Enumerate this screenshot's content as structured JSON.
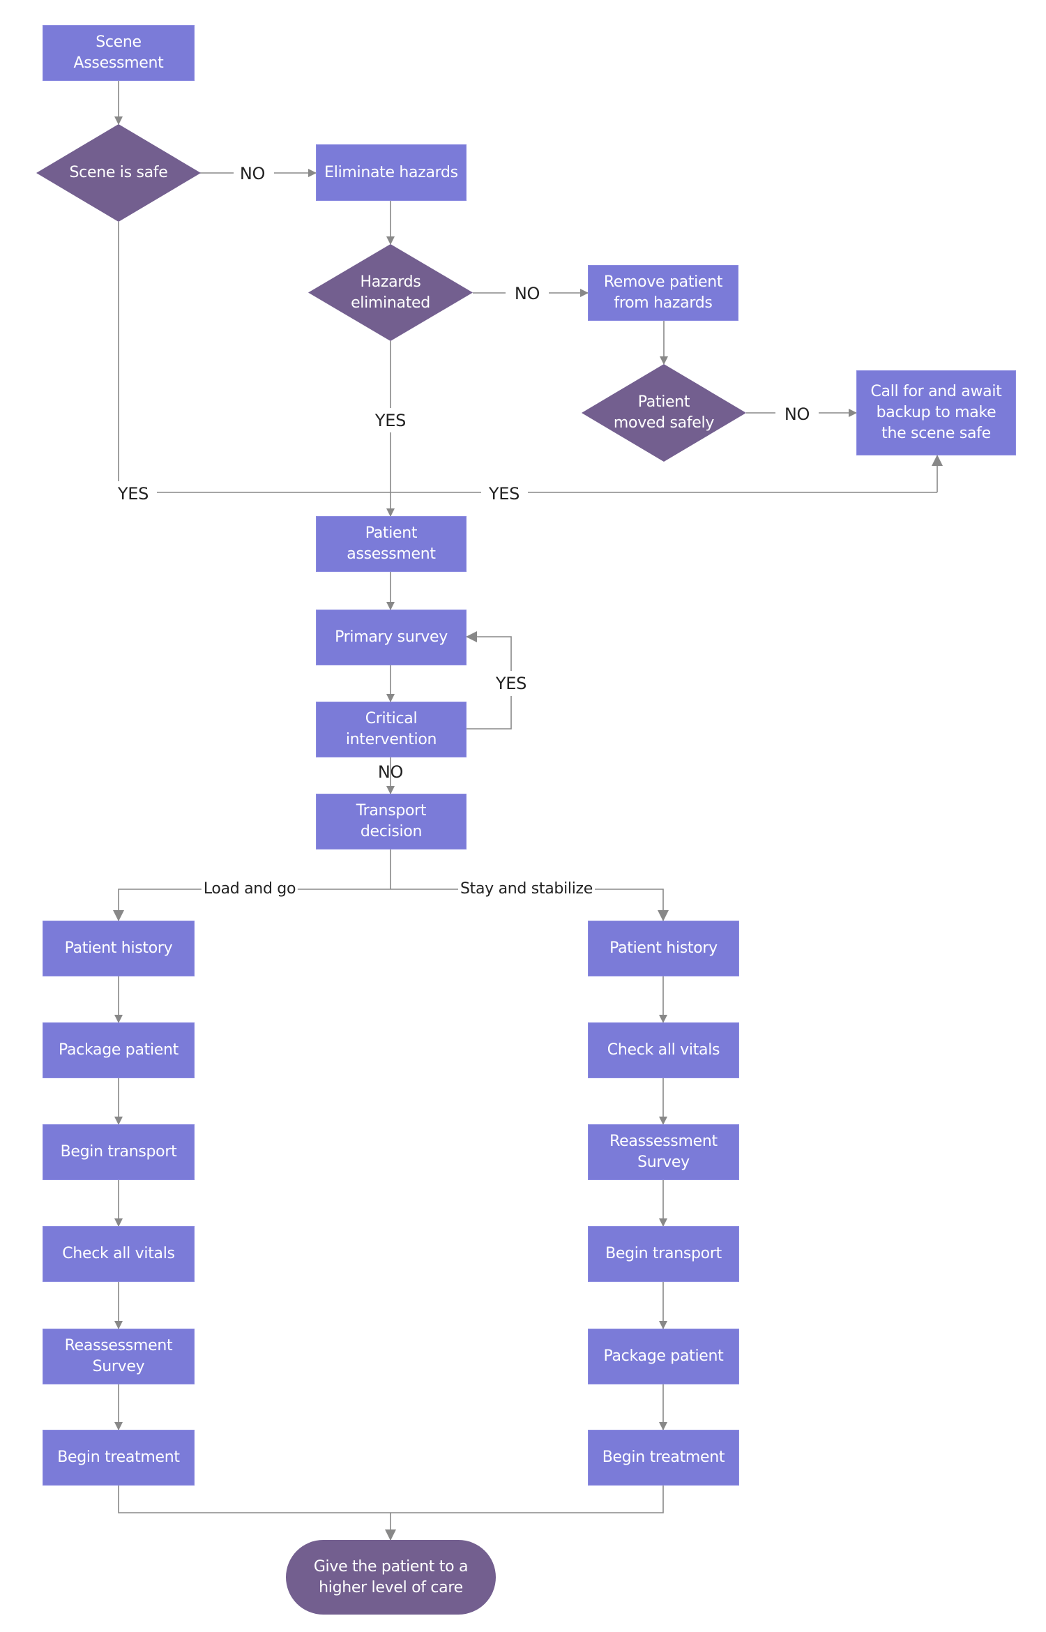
{
  "colors": {
    "process_fill": "#7b7bd8",
    "decision_fill": "#735f8f",
    "terminal_fill": "#735f8f",
    "connector": "#888888",
    "label_text": "#222222",
    "node_text": "#ffffff"
  },
  "nodes": {
    "scene_assessment": "Scene\nAssessment",
    "scene_is_safe": "Scene is safe",
    "eliminate_hazards": "Eliminate hazards",
    "hazards_eliminated": "Hazards\neliminated",
    "remove_patient": "Remove patient\nfrom hazards",
    "patient_moved_safely": "Patient\nmoved safely",
    "call_for_backup": "Call for and await\nbackup to make\nthe scene safe",
    "patient_assessment": "Patient\nassessment",
    "primary_survey": "Primary survey",
    "critical_intervention": "Critical\nintervention",
    "transport_decision": "Transport\ndecision",
    "give_patient": "Give the patient to a\nhigher level of care"
  },
  "load_and_go": {
    "branch_label": "Load and go",
    "steps": [
      "Patient history",
      "Package patient",
      "Begin transport",
      "Check all vitals",
      "Reassessment\nSurvey",
      "Begin treatment"
    ]
  },
  "stay_and_stabilize": {
    "branch_label": "Stay and stabilize",
    "steps": [
      "Patient history",
      "Check all vitals",
      "Reassessment\nSurvey",
      "Begin transport",
      "Package patient",
      "Begin treatment"
    ]
  },
  "edge_labels": {
    "scene_safe_no": "NO",
    "scene_safe_yes": "YES",
    "hazards_no": "NO",
    "hazards_yes": "YES",
    "moved_no": "NO",
    "moved_yes": "YES",
    "critical_yes": "YES",
    "critical_no": "NO"
  }
}
